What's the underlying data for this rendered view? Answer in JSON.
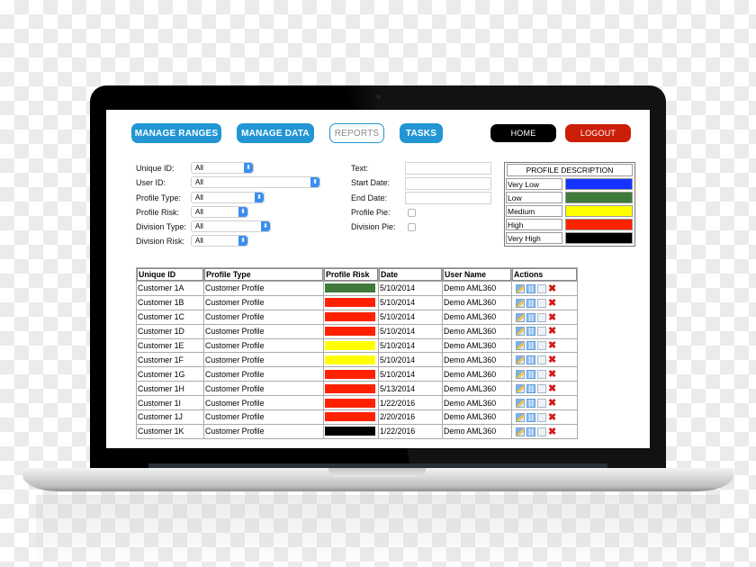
{
  "nav": {
    "manage_ranges": "MANAGE RANGES",
    "manage_data": "MANAGE DATA",
    "reports": "REPORTS",
    "tasks": "TASKS",
    "home": "HOME",
    "logout": "LOGOUT"
  },
  "filters": {
    "unique_id": {
      "label": "Unique ID:",
      "value": "All"
    },
    "user_id": {
      "label": "User ID:",
      "value": "All"
    },
    "profile_type": {
      "label": "Profile Type:",
      "value": "All"
    },
    "profile_risk": {
      "label": "Profile Risk:",
      "value": "All"
    },
    "division_type": {
      "label": "Division Type:",
      "value": "All"
    },
    "division_risk": {
      "label": "Division Risk:",
      "value": "All"
    },
    "text": {
      "label": "Text:",
      "value": ""
    },
    "start_date": {
      "label": "Start Date:",
      "value": ""
    },
    "end_date": {
      "label": "End Date:",
      "value": ""
    },
    "profile_pie": {
      "label": "Profile Pie:",
      "checked": false
    },
    "division_pie": {
      "label": "Division Pie:",
      "checked": false
    }
  },
  "legend": {
    "title": "PROFILE DESCRIPTION",
    "items": [
      {
        "label": "Very Low",
        "color": "#1533ff"
      },
      {
        "label": "Low",
        "color": "#3f7a3a"
      },
      {
        "label": "Medium",
        "color": "#ffff00"
      },
      {
        "label": "High",
        "color": "#ff2200"
      },
      {
        "label": "Very High",
        "color": "#000000"
      }
    ]
  },
  "table": {
    "headers": [
      "Unique ID",
      "Profile Type",
      "Profile Risk",
      "Date",
      "User Name",
      "Actions"
    ],
    "rows": [
      {
        "id": "Customer 1A",
        "type": "Customer Profile",
        "risk": "Low",
        "date": "5/10/2014",
        "user": "Demo AML360"
      },
      {
        "id": "Customer 1B",
        "type": "Customer Profile",
        "risk": "High",
        "date": "5/10/2014",
        "user": "Demo AML360"
      },
      {
        "id": "Customer 1C",
        "type": "Customer Profile",
        "risk": "High",
        "date": "5/10/2014",
        "user": "Demo AML360"
      },
      {
        "id": "Customer 1D",
        "type": "Customer Profile",
        "risk": "High",
        "date": "5/10/2014",
        "user": "Demo AML360"
      },
      {
        "id": "Customer 1E",
        "type": "Customer Profile",
        "risk": "Medium",
        "date": "5/10/2014",
        "user": "Demo AML360"
      },
      {
        "id": "Customer 1F",
        "type": "Customer Profile",
        "risk": "Medium",
        "date": "5/10/2014",
        "user": "Demo AML360"
      },
      {
        "id": "Customer 1G",
        "type": "Customer Profile",
        "risk": "High",
        "date": "5/10/2014",
        "user": "Demo AML360"
      },
      {
        "id": "Customer 1H",
        "type": "Customer Profile",
        "risk": "High",
        "date": "5/13/2014",
        "user": "Demo AML360"
      },
      {
        "id": "Customer 1I",
        "type": "Customer Profile",
        "risk": "High",
        "date": "1/22/2016",
        "user": "Demo AML360"
      },
      {
        "id": "Customer 1J",
        "type": "Customer Profile",
        "risk": "High",
        "date": "2/20/2016",
        "user": "Demo AML360"
      },
      {
        "id": "Customer 1K",
        "type": "Customer Profile",
        "risk": "Very High",
        "date": "1/22/2016",
        "user": "Demo AML360"
      }
    ],
    "actions": [
      "edit-icon",
      "grid-view-icon",
      "document-icon",
      "delete-icon"
    ]
  }
}
